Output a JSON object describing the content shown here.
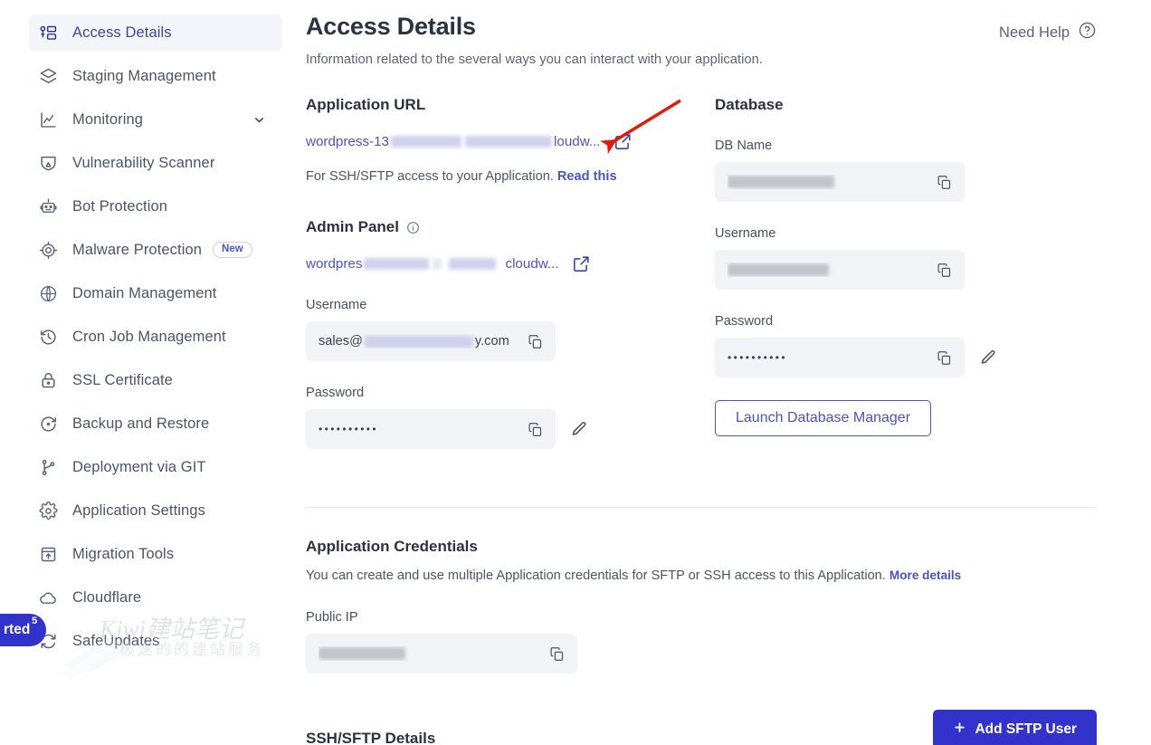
{
  "sidebar": {
    "items": [
      {
        "label": "Access Details",
        "icon": "key-card-icon",
        "active": true
      },
      {
        "label": "Staging Management",
        "icon": "layers-icon",
        "active": false
      },
      {
        "label": "Monitoring",
        "icon": "chart-line-icon",
        "active": false,
        "chevron": "chevron-down-icon"
      },
      {
        "label": "Vulnerability Scanner",
        "icon": "shield-scan-icon",
        "active": false
      },
      {
        "label": "Bot Protection",
        "icon": "robot-icon",
        "active": false
      },
      {
        "label": "Malware Protection",
        "icon": "target-bug-icon",
        "active": false,
        "badge": "New"
      },
      {
        "label": "Domain Management",
        "icon": "www-globe-icon",
        "active": false
      },
      {
        "label": "Cron Job Management",
        "icon": "clock-history-icon",
        "active": false
      },
      {
        "label": "SSL Certificate",
        "icon": "lock-icon",
        "active": false
      },
      {
        "label": "Backup and Restore",
        "icon": "restore-icon",
        "active": false
      },
      {
        "label": "Deployment via GIT",
        "icon": "git-branch-icon",
        "active": false
      },
      {
        "label": "Application Settings",
        "icon": "gear-icon",
        "active": false
      },
      {
        "label": "Migration Tools",
        "icon": "migration-upload-icon",
        "active": false
      },
      {
        "label": "Cloudflare",
        "icon": "cloud-icon",
        "active": false
      },
      {
        "label": "SafeUpdates",
        "icon": "refresh-sync-icon",
        "active": false
      }
    ],
    "get_started": {
      "label": "rted",
      "count": "5"
    }
  },
  "watermark": {
    "main": "Kiwi建站笔记",
    "sub": "极速的的建站服务"
  },
  "header": {
    "title": "Access Details",
    "subtitle": "Information related to the several ways you can interact with your application.",
    "need_help": "Need Help",
    "help_icon": "question-circle-icon"
  },
  "application_url": {
    "section_title": "Application URL",
    "url_prefix": "wordpress-13",
    "url_suffix": "loudw...",
    "external_icon": "external-link-icon",
    "note_text": "For SSH/SFTP access to your Application.",
    "note_link": "Read this"
  },
  "admin_panel": {
    "section_title": "Admin Panel",
    "info_icon": "info-circle-icon",
    "url_prefix": "wordpres",
    "url_mid": "",
    "url_suffix": "cloudw...",
    "external_icon": "external-link-icon",
    "username_label": "Username",
    "username_prefix": "sales@",
    "username_suffix": "y.com",
    "password_label": "Password",
    "password_value": "••••••••••",
    "copy_icon": "copy-icon",
    "edit_icon": "pencil-icon"
  },
  "database": {
    "section_title": "Database",
    "db_name_label": "DB Name",
    "db_name_value": "",
    "username_label": "Username",
    "username_value": "",
    "password_label": "Password",
    "password_value": "••••••••••",
    "copy_icon": "copy-icon",
    "edit_icon": "pencil-icon",
    "launch_button": "Launch Database Manager"
  },
  "application_credentials": {
    "section_title": "Application Credentials",
    "description": "You can create and use multiple Application credentials for SFTP or SSH access to this Application.",
    "description_link": "More details",
    "public_ip_label": "Public IP",
    "public_ip_value": "",
    "copy_icon": "copy-icon"
  },
  "ssh_sftp": {
    "section_title": "SSH/SFTP Details",
    "add_button": "Add SFTP User",
    "add_icon": "plus-icon"
  },
  "annotation": {
    "arrow_color": "#e01b0c",
    "type": "red-arrow"
  },
  "colors": {
    "primary": "#3333cc",
    "link": "#4c54b8",
    "field_bg": "#f2f3f7",
    "active_nav_bg": "#f4f5fa"
  }
}
